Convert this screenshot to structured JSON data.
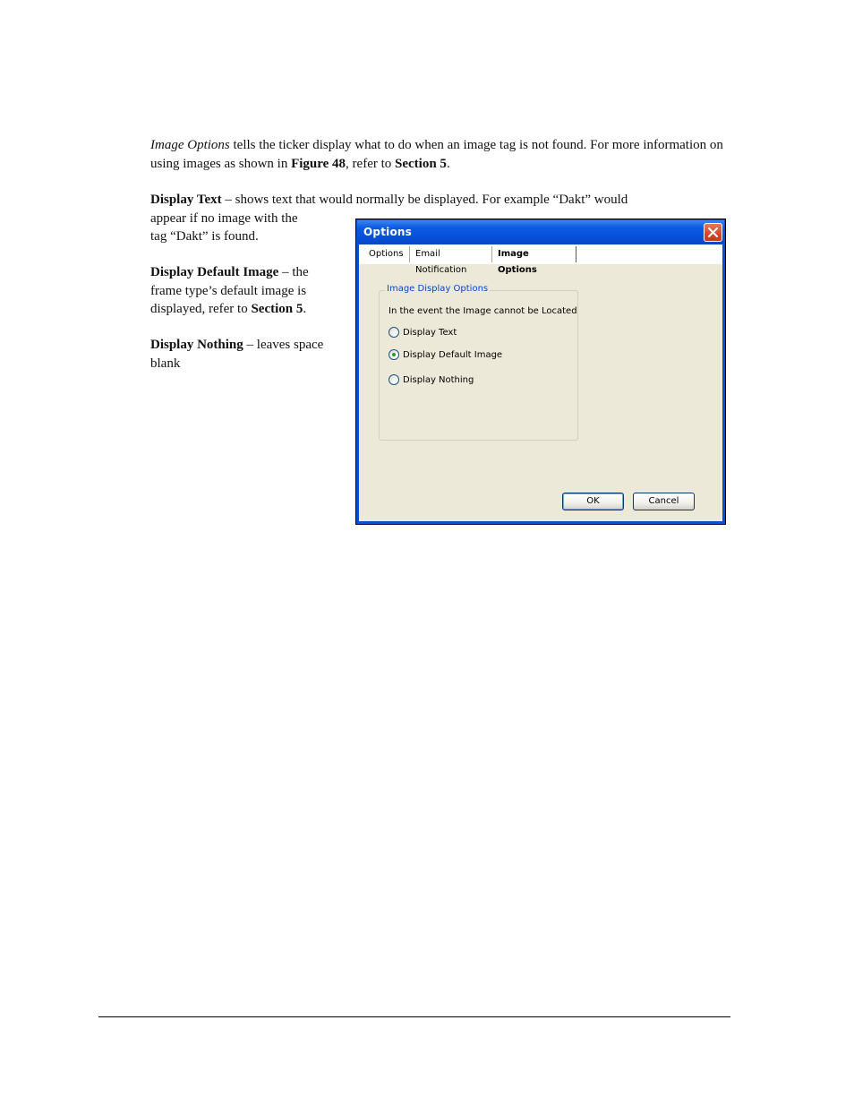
{
  "intro": {
    "term": "Image Options",
    "text1": " tells the ticker display what to do when an image tag is not found. For more information on using images as shown in ",
    "fig_ref": "Figure 48",
    "text2": ", refer to ",
    "section_ref": "Section 5",
    "text3": "."
  },
  "display_text_para": {
    "term": "Display Text",
    "text_a": " – shows text that would normally be displayed. For example “Dakt” would",
    "text_b": "appear if no image with the",
    "text_c": "tag “Dakt” is found."
  },
  "display_default_para": {
    "term": "Display Default Image",
    "text1": " – the frame type’s default image is displayed, refer to ",
    "section_ref": "Section 5",
    "text2": "."
  },
  "display_nothing_para": {
    "term": "Display Nothing",
    "text": " – leaves space blank"
  },
  "dialog": {
    "title": "Options",
    "tabs": [
      "Options",
      "Email Notification",
      "Image Options"
    ],
    "active_tab": "Image Options",
    "group_title": "Image Display Options",
    "description": "In the event the Image cannot be Located",
    "radios": [
      {
        "label": "Display Text",
        "checked": false
      },
      {
        "label": "Display Default Image",
        "checked": true
      },
      {
        "label": "Display Nothing",
        "checked": false
      }
    ],
    "ok_label": "OK",
    "cancel_label": "Cancel"
  },
  "colors": {
    "titlebar": "#0a4fd6",
    "dialog_face": "#ece9d8",
    "group_title": "#0046d5",
    "close_button": "#d5482a"
  }
}
